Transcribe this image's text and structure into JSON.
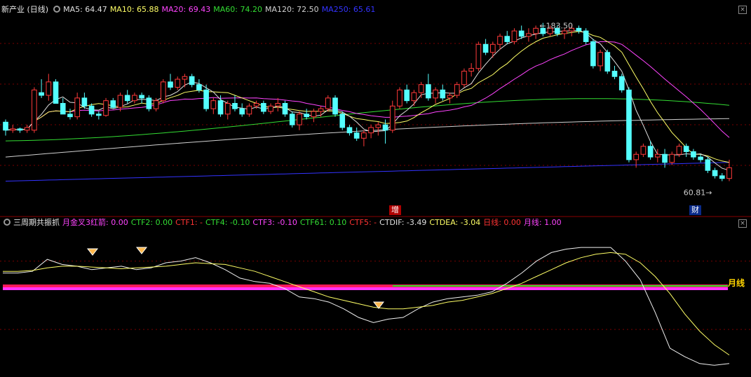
{
  "main": {
    "title": "新产业 (日线)",
    "ma": [
      {
        "label": "MA5: 64.47",
        "color": "#e0e0e0"
      },
      {
        "label": "MA10: 65.88",
        "color": "#ffff66"
      },
      {
        "label": "MA20: 69.43",
        "color": "#ff44ff"
      },
      {
        "label": "MA60: 74.20",
        "color": "#33dd33"
      },
      {
        "label": "MA120: 72.50",
        "color": "#d0d0d0"
      },
      {
        "label": "MA250: 65.61",
        "color": "#3333ff"
      }
    ],
    "high_label": "183.50",
    "low_label": "60.81",
    "event_left": "增",
    "event_right": "财"
  },
  "indicator": {
    "title": "三周期共振抓",
    "items": [
      {
        "label": "月金叉3红箭: 0.00",
        "color": "#ff44ff"
      },
      {
        "label": "CTF2: 0.00",
        "color": "#33dd33"
      },
      {
        "label": "CTF1: -",
        "color": "#ff3333"
      },
      {
        "label": "CTF4: -0.10",
        "color": "#33dd33"
      },
      {
        "label": "CTF3: -0.10",
        "color": "#ff44ff"
      },
      {
        "label": "CTF61: 0.10",
        "color": "#33dd33"
      },
      {
        "label": "CTF5: -",
        "color": "#ff3333"
      },
      {
        "label": "CTDIF: -3.49",
        "color": "#e0e0e0"
      },
      {
        "label": "CTDEA: -3.04",
        "color": "#ffff66"
      },
      {
        "label": "日线: 0.00",
        "color": "#ff3333"
      },
      {
        "label": "月线: 1.00",
        "color": "#ff44ff"
      }
    ],
    "band_label": "月线"
  },
  "chart_data": [
    {
      "type": "candlestick",
      "title": "新产业 (日线)",
      "candles": [
        [
          77,
          78,
          72,
          74
        ],
        [
          74,
          76,
          73,
          74.5
        ],
        [
          74.5,
          75,
          73,
          74
        ],
        [
          74,
          76,
          73,
          75
        ],
        [
          74,
          90,
          73,
          89
        ],
        [
          88,
          93,
          86,
          87
        ],
        [
          87,
          95,
          85,
          92
        ],
        [
          92,
          93,
          84,
          84
        ],
        [
          84,
          86,
          80,
          80
        ],
        [
          80,
          82,
          78,
          79
        ],
        [
          79,
          88,
          78,
          86
        ],
        [
          86,
          88,
          82,
          83
        ],
        [
          83,
          84,
          79,
          80
        ],
        [
          80,
          81,
          78,
          79.5
        ],
        [
          79.5,
          86,
          79,
          85
        ],
        [
          85,
          86,
          82,
          82.5
        ],
        [
          82.5,
          88,
          81,
          87
        ],
        [
          87,
          89,
          84,
          85
        ],
        [
          85,
          88,
          84,
          87
        ],
        [
          87,
          88,
          84,
          86
        ],
        [
          86,
          87,
          81,
          82
        ],
        [
          82,
          86,
          81,
          85
        ],
        [
          85,
          93,
          84,
          92
        ],
        [
          92,
          95,
          89,
          90
        ],
        [
          90,
          94,
          89,
          93
        ],
        [
          93,
          95,
          90,
          94
        ],
        [
          94,
          95,
          90,
          91
        ],
        [
          91,
          93,
          88,
          89
        ],
        [
          89,
          91,
          81,
          82
        ],
        [
          82,
          86,
          80,
          85
        ],
        [
          85,
          87,
          79,
          80
        ],
        [
          80,
          85,
          78,
          84
        ],
        [
          84,
          87,
          81,
          82
        ],
        [
          82,
          84,
          79,
          80
        ],
        [
          80,
          84,
          79,
          83
        ],
        [
          83,
          85,
          82,
          84
        ],
        [
          84,
          85,
          80,
          81
        ],
        [
          81,
          84,
          80,
          83
        ],
        [
          83,
          86,
          81,
          84
        ],
        [
          84,
          85,
          79,
          80
        ],
        [
          80,
          81,
          75,
          76
        ],
        [
          76,
          81,
          74,
          80
        ],
        [
          80,
          82,
          78,
          79
        ],
        [
          79,
          82,
          77,
          81
        ],
        [
          81,
          83,
          79,
          82
        ],
        [
          82,
          87,
          81,
          86
        ],
        [
          86,
          87,
          79,
          80
        ],
        [
          80,
          81,
          74,
          75
        ],
        [
          75,
          76,
          72,
          73
        ],
        [
          73,
          75,
          70,
          71
        ],
        [
          71,
          74,
          68,
          73
        ],
        [
          73,
          76,
          71,
          75
        ],
        [
          75,
          77,
          72,
          76
        ],
        [
          76,
          78,
          69,
          74
        ],
        [
          74,
          85,
          73,
          83
        ],
        [
          83,
          90,
          82,
          89
        ],
        [
          89,
          91,
          84,
          85
        ],
        [
          85,
          89,
          83,
          88
        ],
        [
          88,
          92,
          86,
          91
        ],
        [
          91,
          95,
          85,
          86
        ],
        [
          86,
          90,
          84,
          89
        ],
        [
          89,
          91,
          85,
          86
        ],
        [
          86,
          88,
          84,
          87
        ],
        [
          87,
          92,
          86,
          91
        ],
        [
          91,
          97,
          90,
          96
        ],
        [
          96,
          99,
          94,
          97
        ],
        [
          97,
          107,
          96,
          106
        ],
        [
          106,
          108,
          102,
          103
        ],
        [
          103,
          107,
          101,
          106
        ],
        [
          106,
          110,
          104,
          109
        ],
        [
          109,
          111,
          106,
          107
        ],
        [
          107,
          112,
          106,
          111
        ],
        [
          111,
          113,
          108,
          109
        ],
        [
          109,
          112,
          107,
          110
        ],
        [
          110,
          113,
          108,
          112
        ],
        [
          112,
          114,
          109,
          110
        ],
        [
          110,
          113,
          109,
          112
        ],
        [
          112,
          113,
          109,
          110
        ],
        [
          110,
          112,
          108,
          111
        ],
        [
          111,
          113,
          109,
          112
        ],
        [
          112,
          113,
          110,
          111
        ],
        [
          111,
          112,
          106,
          107
        ],
        [
          107,
          108,
          97,
          98
        ],
        [
          98,
          104,
          96,
          103
        ],
        [
          103,
          104,
          95,
          96
        ],
        [
          96,
          98,
          93,
          94
        ],
        [
          94,
          95,
          88,
          89
        ],
        [
          89,
          90,
          62,
          63
        ],
        [
          63,
          66,
          60,
          65
        ],
        [
          65,
          69,
          64,
          68
        ],
        [
          68,
          70,
          63,
          64
        ],
        [
          64,
          67,
          62,
          65
        ],
        [
          65,
          67,
          60,
          62
        ],
        [
          62,
          66,
          61,
          65
        ],
        [
          65,
          69,
          64,
          68
        ],
        [
          68,
          69,
          64,
          66
        ],
        [
          66,
          67,
          63,
          64
        ],
        [
          64,
          65,
          62,
          63
        ],
        [
          63,
          64,
          58,
          59
        ],
        [
          59,
          60,
          56,
          57
        ],
        [
          57,
          58,
          55,
          56
        ],
        [
          56,
          63,
          55,
          60
        ]
      ],
      "ma_current": {
        "MA5": 64.47,
        "MA10": 65.88,
        "MA20": 69.43,
        "MA60": 74.2,
        "MA120": 72.5,
        "MA250": 65.61
      },
      "annotations": {
        "high": 183.5,
        "low": 60.81
      }
    },
    {
      "type": "line",
      "title": "三周期共振抓",
      "series": [
        {
          "name": "CTDIF",
          "values": [
            1.8,
            1.8,
            1.9,
            2.6,
            2.3,
            2.2,
            2.0,
            2.1,
            2.2,
            2.0,
            2.1,
            2.4,
            2.5,
            2.7,
            2.4,
            2.0,
            1.5,
            1.3,
            1.2,
            0.9,
            0.4,
            0.3,
            0.1,
            -0.3,
            -0.8,
            -1.1,
            -0.9,
            -0.8,
            -0.3,
            0.1,
            0.3,
            0.4,
            0.5,
            0.7,
            1.2,
            1.8,
            2.5,
            3.0,
            3.2,
            3.3,
            3.3,
            3.3,
            2.5,
            1.4,
            -0.5,
            -2.6,
            -3.1,
            -3.5,
            -3.6,
            -3.5
          ]
        },
        {
          "name": "CTDEA",
          "values": [
            1.9,
            1.9,
            1.95,
            2.1,
            2.2,
            2.2,
            2.15,
            2.1,
            2.05,
            2.1,
            2.15,
            2.2,
            2.3,
            2.4,
            2.35,
            2.3,
            2.1,
            1.9,
            1.6,
            1.3,
            1.0,
            0.7,
            0.4,
            0.2,
            0.0,
            -0.2,
            -0.3,
            -0.3,
            -0.2,
            -0.1,
            0.1,
            0.2,
            0.4,
            0.6,
            0.9,
            1.2,
            1.6,
            2.0,
            2.4,
            2.7,
            2.9,
            3.0,
            2.9,
            2.4,
            1.6,
            0.6,
            -0.6,
            -1.6,
            -2.4,
            -3.0
          ]
        }
      ],
      "markers": [
        "diamond",
        "diamond",
        "diamond"
      ]
    }
  ]
}
